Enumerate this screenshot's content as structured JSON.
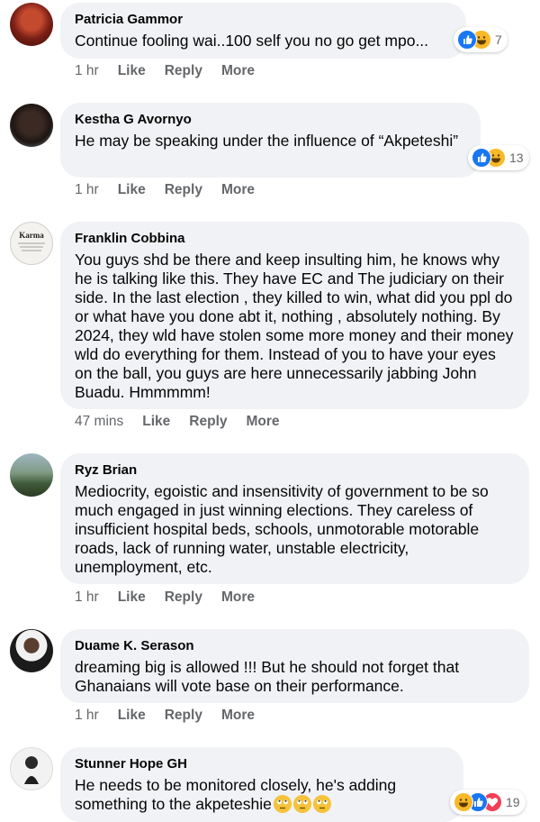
{
  "comments": [
    {
      "author": "Patricia Gammor",
      "text": "Continue fooling wai..100 self you no go get mpo...",
      "time": "1 hr",
      "reaction_count": "7",
      "reactions": [
        "like-icon",
        "haha-icon"
      ]
    },
    {
      "author": "Kestha G Avornyo",
      "text": "He may be speaking under the influence of “Akpeteshi”",
      "time": "1 hr",
      "reaction_count": "13",
      "reactions": [
        "like-icon",
        "haha-icon"
      ]
    },
    {
      "author": "Franklin Cobbina",
      "text": "You guys shd be there and keep insulting him, he knows why he is talking like this. They have EC and The judiciary on their side. In the last election , they killed to win, what did you ppl do or what have you done abt it, nothing , absolutely nothing. By 2024, they wld have stolen some more money and their money wld do everything for them. Instead of you to have your eyes on the ball, you guys are here unnecessarily jabbing John Buadu. Hmmmmm!",
      "time": "47 mins",
      "avatar_text": "Karma"
    },
    {
      "author": "Ryz Brian",
      "text": "Mediocrity, egoistic and insensitivity of government to be so much engaged in just winning elections. They careless of insufficient hospital beds, schools, unmotorable motorable roads, lack of running water, unstable electricity, unemployment, etc.",
      "time": "1 hr"
    },
    {
      "author": "Duame K. Serason",
      "text": "dreaming big is allowed !!! But he should not forget that Ghanaians will vote base on their performance.",
      "time": "1 hr"
    },
    {
      "author": "Stunner Hope GH",
      "text": "He needs to be monitored closely, he's adding something to the akpeteshie",
      "time": "",
      "reaction_count": "19",
      "reactions": [
        "haha-icon",
        "like-icon",
        "love-icon"
      ],
      "trailing_emoji": [
        "eye-roll-emoji",
        "eye-roll-emoji",
        "eye-roll-emoji"
      ]
    }
  ],
  "actions": {
    "like": "Like",
    "reply": "Reply",
    "more": "More"
  },
  "colors": {
    "bubble": "#f0f2f5",
    "meta": "#65676b",
    "like": "#1877f2",
    "haha": "#f7b928",
    "love": "#f33e58"
  }
}
